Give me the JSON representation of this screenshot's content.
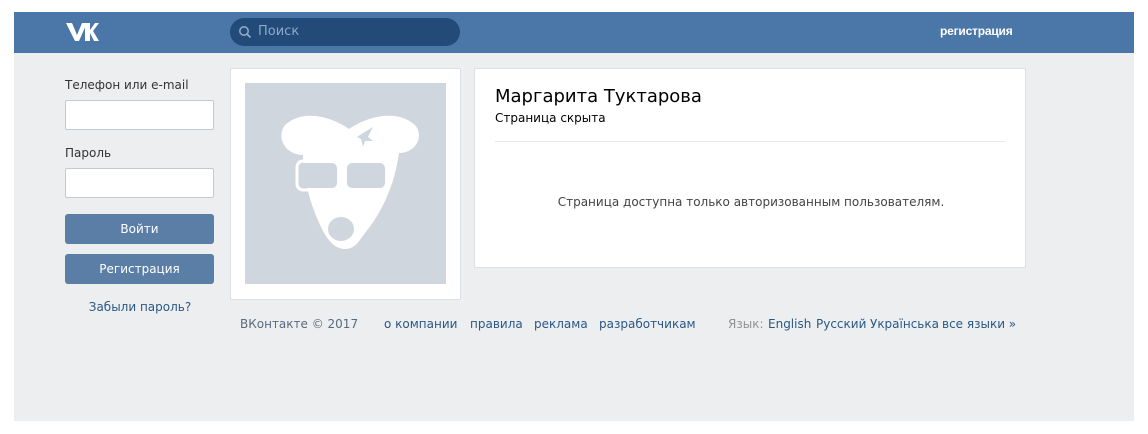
{
  "header": {
    "logo_icon": "vk-logo-icon",
    "search_placeholder": "Поиск",
    "register_link": "регистрация"
  },
  "login": {
    "phone_label": "Телефон или e-mail",
    "phone_value": "",
    "password_label": "Пароль",
    "password_value": "",
    "login_button": "Войти",
    "register_button": "Регистрация",
    "forgot_link": "Забыли пароль?"
  },
  "profile": {
    "name": "Маргарита Туктарова",
    "status": "Страница скрыта",
    "notice": "Страница доступна только авторизованным пользователям."
  },
  "footer": {
    "copyright": "ВКонтакте © 2017",
    "links": [
      "о компании",
      "правила",
      "реклама",
      "разработчикам"
    ],
    "language_label": "Язык:",
    "languages": [
      "English",
      "Русский",
      "Українська",
      "все языки »"
    ]
  },
  "colors": {
    "header": "#4a76a8",
    "background": "#edeef0",
    "button": "#5b7ea7",
    "link": "#2a5885"
  }
}
